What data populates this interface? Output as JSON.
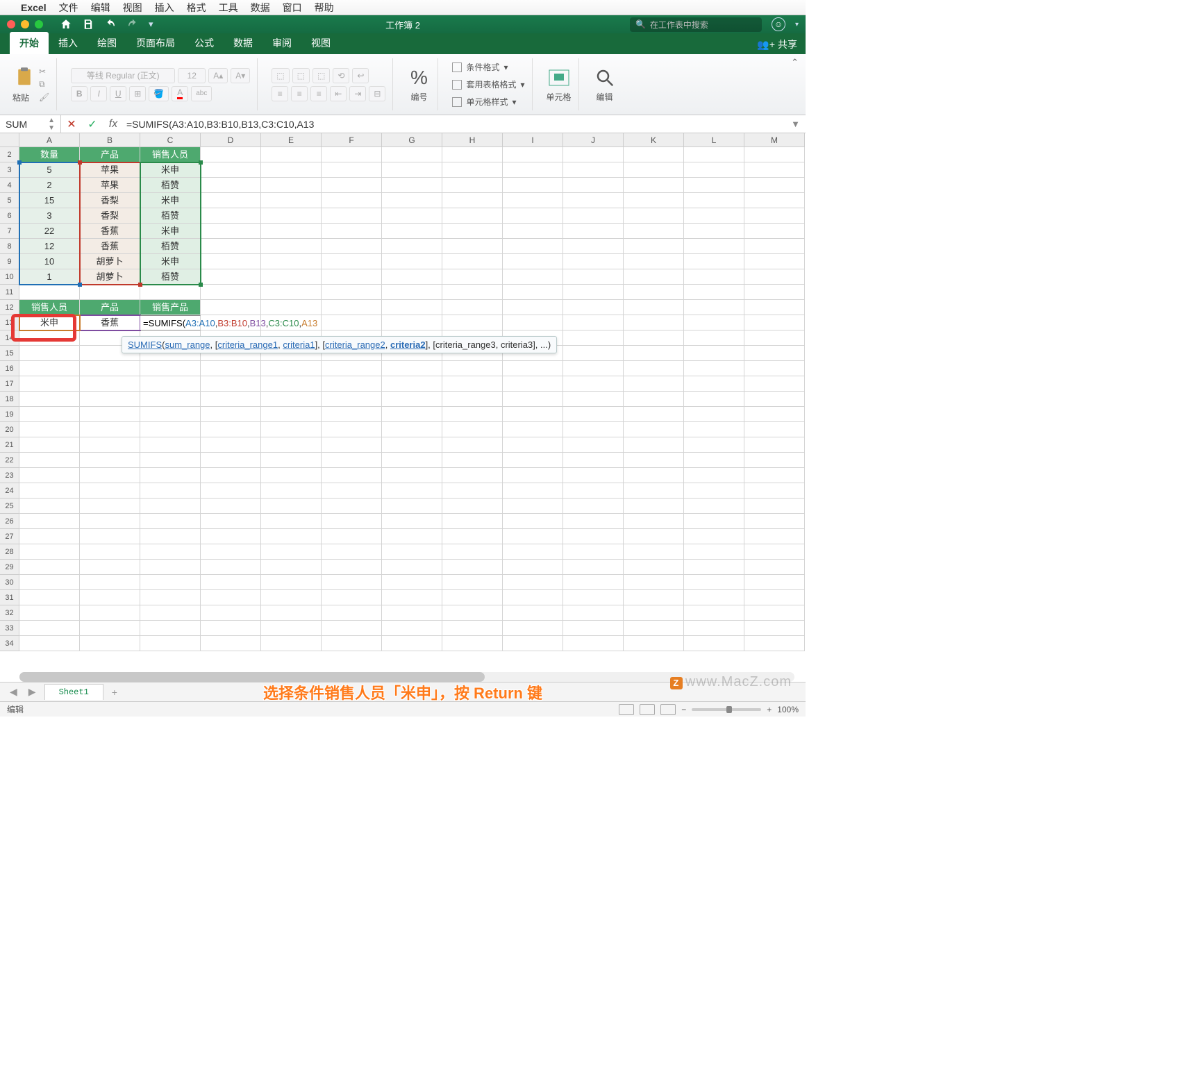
{
  "mac_menu": {
    "app": "Excel",
    "items": [
      "文件",
      "编辑",
      "视图",
      "插入",
      "格式",
      "工具",
      "数据",
      "窗口",
      "帮助"
    ]
  },
  "titlebar": {
    "title": "工作簿 2",
    "search_placeholder": "在工作表中搜索"
  },
  "ribbon_tabs": [
    "开始",
    "插入",
    "绘图",
    "页面布局",
    "公式",
    "数据",
    "审阅",
    "视图"
  ],
  "share_label": "共享",
  "ribbon": {
    "paste": "粘贴",
    "font_name": "等线 Regular (正文)",
    "font_size": "12",
    "number_group": "编号",
    "fmt1": "条件格式",
    "fmt2": "套用表格格式",
    "fmt3": "单元格样式",
    "cells": "单元格",
    "edit": "编辑"
  },
  "name_box": "SUM",
  "formula": "=SUMIFS(A3:A10,B3:B10,B13,C3:C10,A13",
  "columns": [
    "A",
    "B",
    "C",
    "D",
    "E",
    "F",
    "G",
    "H",
    "I",
    "J",
    "K",
    "L",
    "M"
  ],
  "row_start": 2,
  "row_end": 34,
  "table1": {
    "headers": [
      "数量",
      "产品",
      "销售人员"
    ],
    "rows": [
      [
        "5",
        "苹果",
        "米申"
      ],
      [
        "2",
        "苹果",
        "栢赞"
      ],
      [
        "15",
        "香梨",
        "米申"
      ],
      [
        "3",
        "香梨",
        "栢赞"
      ],
      [
        "22",
        "香蕉",
        "米申"
      ],
      [
        "12",
        "香蕉",
        "栢赞"
      ],
      [
        "10",
        "胡萝卜",
        "米申"
      ],
      [
        "1",
        "胡萝卜",
        "栢赞"
      ]
    ]
  },
  "table2": {
    "headers": [
      "销售人员",
      "产品",
      "销售产品"
    ],
    "row": [
      "米申",
      "香蕉",
      ""
    ]
  },
  "cell_formula": "=SUMIFS(A3:A10,B3:B10,B13,C3:C10,A13",
  "tooltip": {
    "fn": "SUMIFS",
    "parts": [
      "sum_range",
      "criteria_range1",
      "criteria1",
      "criteria_range2",
      "criteria2",
      "[criteria_range3, criteria3], ..."
    ]
  },
  "sheet_tab": "Sheet1",
  "caption": "选择条件销售人员「米申」，按 Return 键",
  "status": {
    "mode": "编辑",
    "zoom": "100%"
  },
  "watermark": "www.MacZ.com"
}
